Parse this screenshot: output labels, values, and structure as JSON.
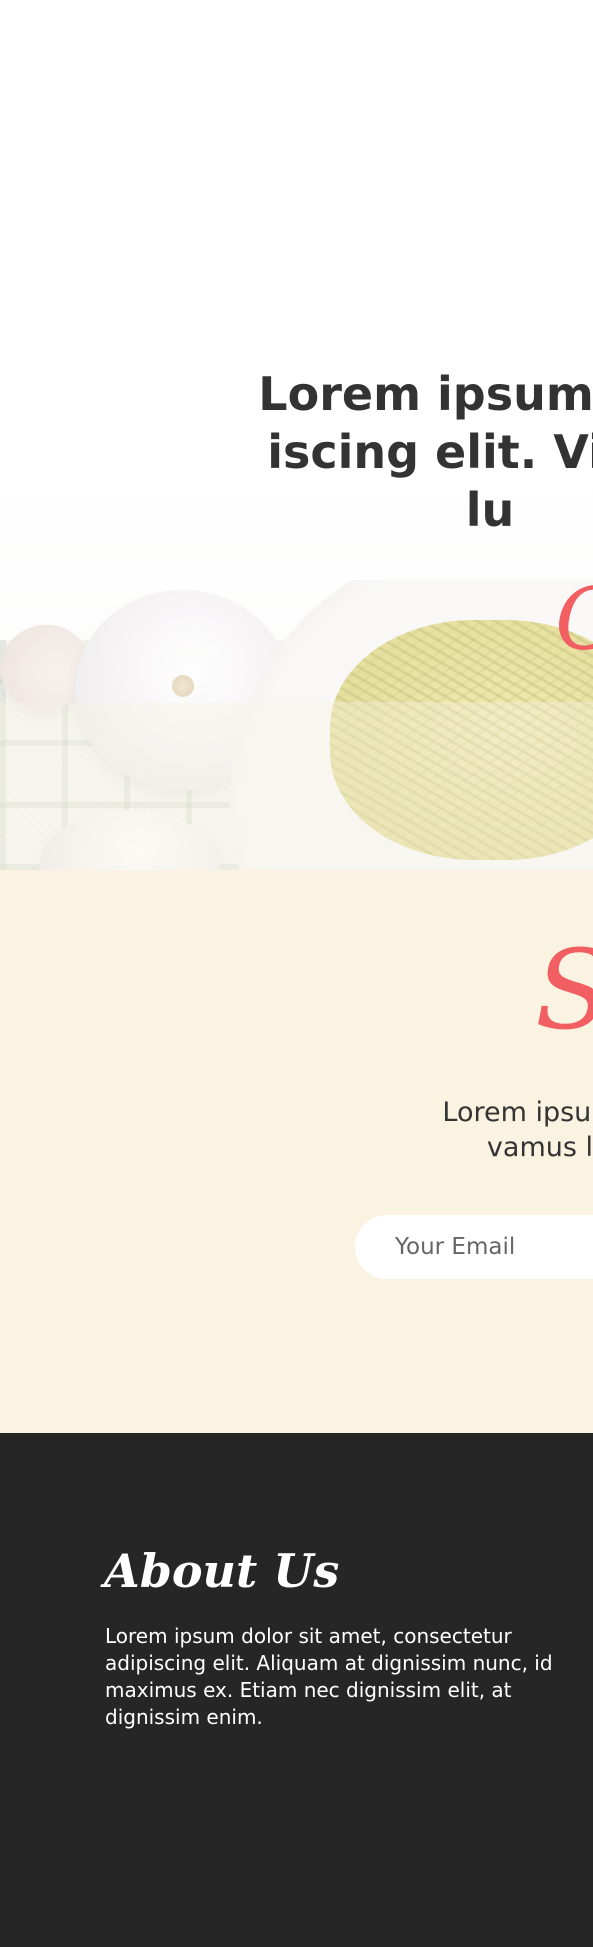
{
  "hero": {
    "heading_lines": [
      "Lorem ipsum dolo",
      "iscing elit. Vivam",
      "lu"
    ],
    "script_text": "C"
  },
  "subscribe": {
    "title": "Su",
    "text_lines": [
      "Lorem ipsum dolor s",
      "vamus lacinia"
    ],
    "email_placeholder": "Your Email"
  },
  "footer": {
    "about_title": "About Us",
    "about_text": "Lorem ipsum dolor sit amet, consectetur adipiscing elit. Aliquam at dignissim nunc, id maximus ex. Etiam nec dignissim elit, at dignissim enim."
  },
  "colors": {
    "accent": "#f25f63",
    "cream": "#faf3e1",
    "footer_bg": "#262626",
    "heading_text": "#333333"
  },
  "icons": []
}
